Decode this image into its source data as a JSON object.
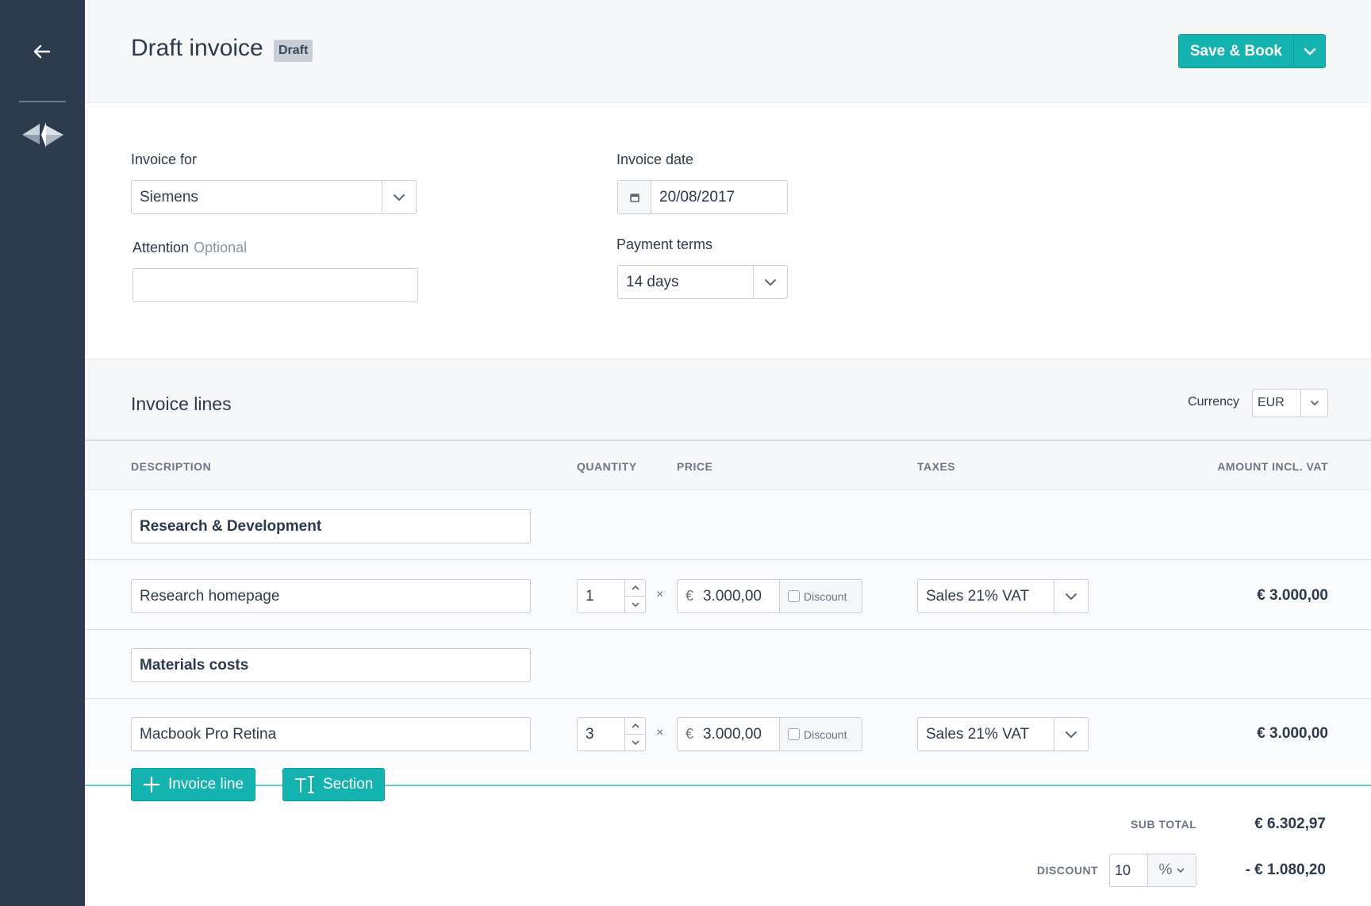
{
  "header": {
    "title": "Draft invoice",
    "status_badge": "Draft",
    "save_label": "Save & Book"
  },
  "form": {
    "invoice_for_label": "Invoice for",
    "invoice_for_value": "Siemens",
    "attention_label": "Attention",
    "attention_optional": "Optional",
    "attention_value": "",
    "invoice_date_label": "Invoice date",
    "invoice_date_value": "20/08/2017",
    "payment_terms_label": "Payment terms",
    "payment_terms_value": "14 days"
  },
  "lines": {
    "title": "Invoice lines",
    "currency_label": "Currency",
    "currency_value": "EUR",
    "columns": {
      "description": "DESCRIPTION",
      "quantity": "QUANTITY",
      "price": "PRICE",
      "taxes": "TAXES",
      "amount": "AMOUNT INCL. VAT"
    },
    "sections": [
      {
        "title": "Research & Development"
      },
      {
        "title": "Materials costs"
      }
    ],
    "items": [
      {
        "description": "Research homepage",
        "quantity": "1",
        "currency_symbol": "€",
        "price": "3.000,00",
        "discount_label": "Discount",
        "tax": "Sales 21% VAT",
        "amount": "€ 3.000,00"
      },
      {
        "description": "Macbook Pro Retina",
        "quantity": "3",
        "currency_symbol": "€",
        "price": "3.000,00",
        "discount_label": "Discount",
        "tax": "Sales 21% VAT",
        "amount": "€ 3.000,00"
      }
    ],
    "times_symbol": "×",
    "add_invoice_line_label": "Invoice line",
    "add_section_label": "Section"
  },
  "totals": {
    "subtotal_label": "SUB TOTAL",
    "subtotal_value": "€ 6.302,97",
    "discount_label": "DISCOUNT",
    "discount_input": "10",
    "discount_unit": "%",
    "discount_value": "- € 1.080,20"
  },
  "colors": {
    "sidebar": "#2c3b4d",
    "accent": "#15b3b0",
    "header_bg": "#f6f7f9"
  }
}
